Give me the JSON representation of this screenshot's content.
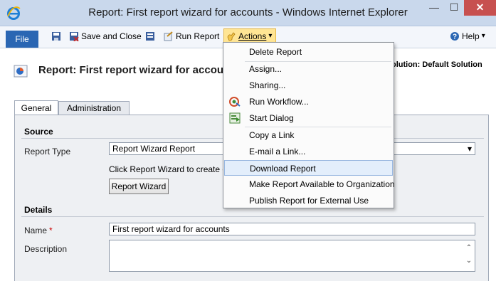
{
  "window": {
    "title": "Report: First report wizard for accounts - Windows Internet Explorer",
    "min_glyph": "—",
    "max_glyph": "☐",
    "close_glyph": "✕"
  },
  "ribbon": {
    "file_label": "File",
    "save_close_label": "Save and Close",
    "run_report_label": "Run Report",
    "actions_label": "Actions",
    "actions_arrow": "▾",
    "help_label": "Help",
    "help_arrow": "▾"
  },
  "header": {
    "form_title": "Report: First report wizard for accounts",
    "solution_label": "olution: Default Solution"
  },
  "tabs": [
    {
      "label": "General",
      "active": true
    },
    {
      "label": "Administration",
      "active": false
    }
  ],
  "source": {
    "heading": "Source",
    "report_type_label": "Report Type",
    "report_type_value": "Report Wizard Report",
    "select_arrow": "▾",
    "info_text": "Click Report Wizard to create o",
    "wizard_button_label": "Report Wizard"
  },
  "details": {
    "heading": "Details",
    "name_label": "Name",
    "required_marker": "*",
    "name_value": "First report wizard for accounts",
    "description_label": "Description",
    "scroll_up": "⌃",
    "scroll_down": "⌄"
  },
  "menu": {
    "items": [
      {
        "label": "Delete Report",
        "icon": ""
      },
      {
        "label": "Assign...",
        "icon": ""
      },
      {
        "label": "Sharing...",
        "icon": ""
      },
      {
        "label": "Run Workflow...",
        "icon": "run-workflow-icon"
      },
      {
        "label": "Start Dialog",
        "icon": "start-dialog-icon"
      },
      {
        "label": "Copy a Link",
        "icon": ""
      },
      {
        "label": "E-mail a Link...",
        "icon": ""
      },
      {
        "label": "Download Report",
        "icon": "",
        "highlighted": true
      },
      {
        "label": "Make Report Available to Organization",
        "icon": ""
      },
      {
        "label": "Publish Report for External Use",
        "icon": ""
      }
    ]
  },
  "colors": {
    "accent": "#2a66b3",
    "actions_highlight": "#ffe594",
    "menu_hover": "#e3eefb",
    "close_button": "#c7504f"
  }
}
